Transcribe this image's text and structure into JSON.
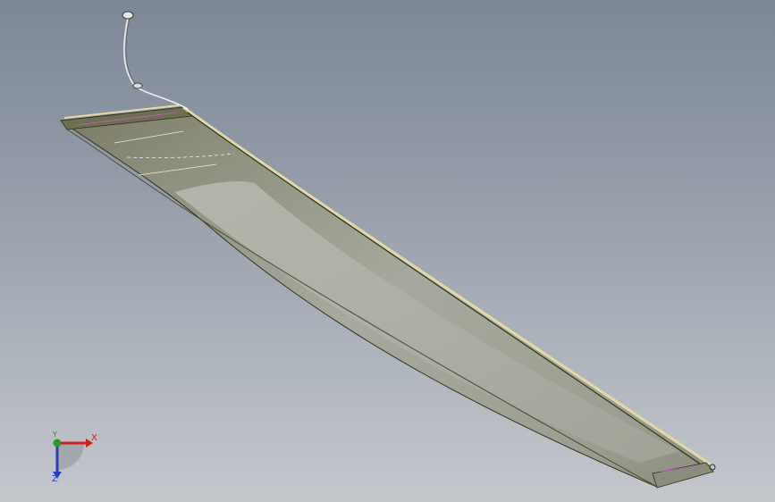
{
  "viewport": {
    "background_top": "#7d8796",
    "background_bottom": "#c4c7cc",
    "model": {
      "name": "blade-assembly",
      "face_color": "#9a9c90",
      "edge_color": "#2f311f",
      "trim_color": "#e3d9a7",
      "highlight_color": "#c060c0"
    }
  },
  "triad": {
    "x_label": "X",
    "y_label": "Y",
    "z_label": "Z",
    "x_color": "#d21e1e",
    "y_color": "#2a9a2a",
    "z_color": "#2a3fbf"
  }
}
